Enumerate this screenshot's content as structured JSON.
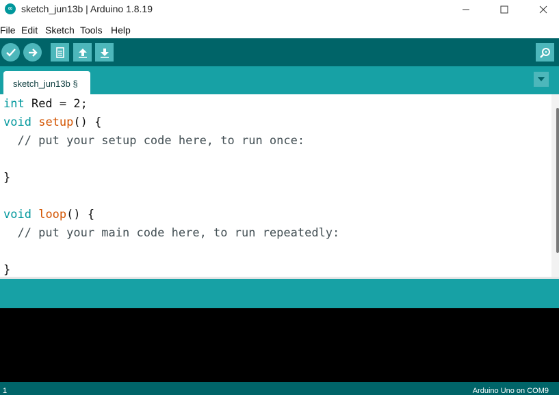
{
  "window": {
    "title": "sketch_jun13b | Arduino 1.8.19",
    "app_icon_text": "∞"
  },
  "menubar": {
    "items": [
      "File",
      "Edit",
      "Sketch",
      "Tools",
      "Help"
    ]
  },
  "toolbar": {
    "verify_icon": "check-icon",
    "upload_icon": "arrow-right-icon",
    "new_icon": "document-icon",
    "open_icon": "arrow-up-icon",
    "save_icon": "arrow-down-icon",
    "serial_monitor_icon": "magnifier-icon"
  },
  "tabs": [
    {
      "label": "sketch_jun13b §"
    }
  ],
  "editor": {
    "lines": [
      {
        "kw": "int",
        "rest": " Red = 2;"
      },
      {
        "kw": "void",
        "fn": "setup",
        "rest": "() {"
      },
      {
        "comment": "  // put your setup code here, to run once:"
      },
      {
        "text": ""
      },
      {
        "text": "}"
      },
      {
        "text": ""
      },
      {
        "kw": "void",
        "fn": "loop",
        "rest": "() {"
      },
      {
        "comment": "  // put your main code here, to run repeatedly:"
      },
      {
        "text": ""
      },
      {
        "text": "}"
      }
    ]
  },
  "footer": {
    "line_number": "1",
    "board": "Arduino Uno on COM9"
  },
  "colors": {
    "toolbar": "#006468",
    "tabbar": "#17a1a5",
    "keyword": "#00979c",
    "function": "#d35400",
    "console": "#000000"
  }
}
